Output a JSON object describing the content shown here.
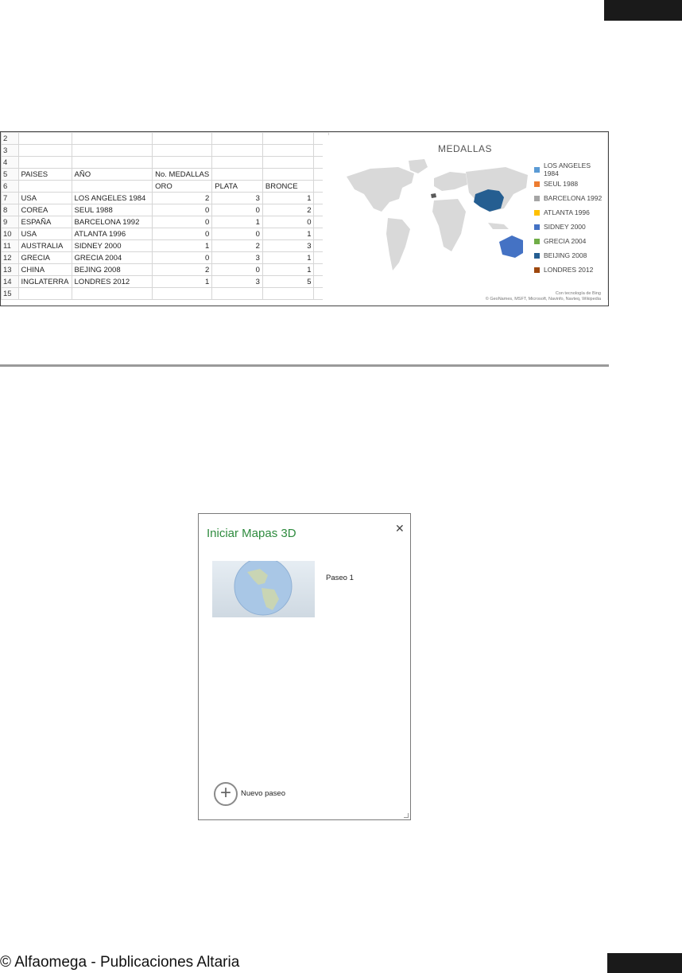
{
  "spreadsheet": {
    "row_numbers": [
      "2",
      "3",
      "4",
      "5",
      "6",
      "7",
      "8",
      "9",
      "10",
      "11",
      "12",
      "13",
      "14",
      "15"
    ],
    "header_row5": {
      "a": "PAISES",
      "b": "AÑO",
      "c": "No. MEDALLAS"
    },
    "header_row6": {
      "c": "ORO",
      "d": "PLATA",
      "e": "BRONCE"
    },
    "rows": [
      {
        "pais": "USA",
        "anio": "LOS ANGELES 1984",
        "oro": "2",
        "plata": "3",
        "bronce": "1"
      },
      {
        "pais": "COREA",
        "anio": "SEUL 1988",
        "oro": "0",
        "plata": "0",
        "bronce": "2"
      },
      {
        "pais": "ESPAÑA",
        "anio": "BARCELONA 1992",
        "oro": "0",
        "plata": "1",
        "bronce": "0"
      },
      {
        "pais": "USA",
        "anio": "ATLANTA 1996",
        "oro": "0",
        "plata": "0",
        "bronce": "1"
      },
      {
        "pais": "AUSTRALIA",
        "anio": "SIDNEY 2000",
        "oro": "1",
        "plata": "2",
        "bronce": "3"
      },
      {
        "pais": "GRECIA",
        "anio": "GRECIA 2004",
        "oro": "0",
        "plata": "3",
        "bronce": "1"
      },
      {
        "pais": "CHINA",
        "anio": "BEJING 2008",
        "oro": "2",
        "plata": "0",
        "bronce": "1"
      },
      {
        "pais": "INGLATERRA",
        "anio": "LONDRES 2012",
        "oro": "1",
        "plata": "3",
        "bronce": "5"
      }
    ]
  },
  "map_chart": {
    "title": "MEDALLAS",
    "legend": [
      {
        "label": "LOS ANGELES 1984",
        "color": "#5b9bd5"
      },
      {
        "label": "SEUL 1988",
        "color": "#ed7d31"
      },
      {
        "label": "BARCELONA 1992",
        "color": "#a5a5a5"
      },
      {
        "label": "ATLANTA 1996",
        "color": "#ffc000"
      },
      {
        "label": "SIDNEY 2000",
        "color": "#4472c4"
      },
      {
        "label": "GRECIA 2004",
        "color": "#70ad47"
      },
      {
        "label": "BEIJING 2008",
        "color": "#255e91"
      },
      {
        "label": "LONDRES 2012",
        "color": "#9e480e"
      }
    ],
    "credit_line1": "Con tecnología de Bing",
    "credit_line2": "© GeoNames, MSFT, Microsoft, Navinfo, Navteq, Wikipedia",
    "land_color": "#d9d9d9",
    "china_color": "#255e91",
    "australia_color": "#4472c4"
  },
  "dialog": {
    "title": "Iniciar Mapas 3D",
    "close_glyph": "✕",
    "tours": [
      {
        "label": "Paseo 1"
      }
    ],
    "new_tour_label": "Nuevo paseo",
    "new_tour_glyph": "+"
  },
  "footer": {
    "text": "© Alfaomega - Publicaciones Altaria"
  }
}
